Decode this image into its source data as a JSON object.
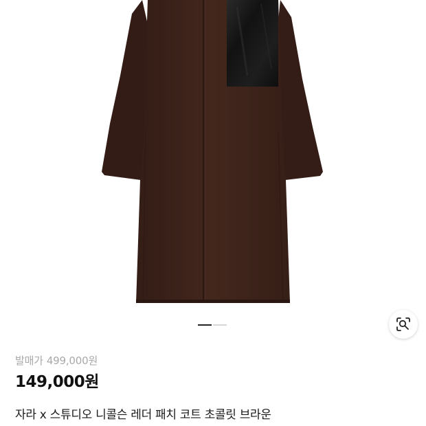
{
  "product": {
    "image_alt": "coat-with-leather-patch",
    "carousel": {
      "count": 2,
      "active_index": 0
    },
    "lens_icon": "image-search-icon",
    "price": {
      "original_label": "발매가",
      "original_value": "499,000원",
      "sale_value": "149,000원"
    },
    "title": "자라 x 스튜디오 니콜슨 레더 패치 코트 초콜릿 브라운"
  },
  "colors": {
    "coat": "#3e241b",
    "coat_shadow": "#2a1711",
    "leather_patch": "#161616",
    "active_indicator": "#222222",
    "inactive_indicator": "#d6d6d6",
    "muted_text": "#a8a8a8",
    "text": "#111111"
  }
}
